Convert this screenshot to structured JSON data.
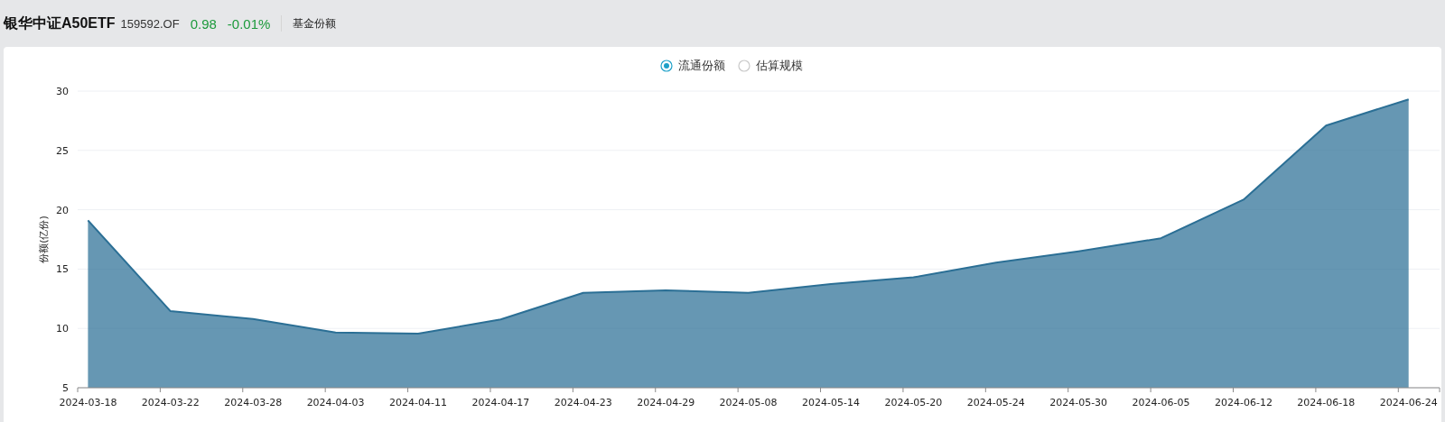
{
  "header": {
    "title": "银华中证A50ETF",
    "code": "159592.OF",
    "price": "0.98",
    "change": "-0.01%",
    "tab": "基金份额"
  },
  "legend": [
    {
      "label": "流通份额",
      "selected": true
    },
    {
      "label": "估算规模",
      "selected": false
    }
  ],
  "chart_data": {
    "type": "area",
    "ylabel": "份额(亿份)",
    "ylim": [
      5,
      30
    ],
    "yticks": [
      5,
      10,
      15,
      20,
      25,
      30
    ],
    "grid": true,
    "categories": [
      "2024-03-18",
      "2024-03-22",
      "2024-03-28",
      "2024-04-03",
      "2024-04-11",
      "2024-04-17",
      "2024-04-23",
      "2024-04-29",
      "2024-05-08",
      "2024-05-14",
      "2024-05-20",
      "2024-05-24",
      "2024-05-30",
      "2024-06-05",
      "2024-06-12",
      "2024-06-18",
      "2024-06-24"
    ],
    "series": [
      {
        "color": "#2b6f95",
        "values": [
          19.1,
          11.45,
          10.8,
          9.65,
          9.55,
          10.75,
          13.0,
          13.2,
          13.0,
          13.75,
          14.3,
          15.55,
          16.5,
          17.6,
          20.85,
          27.1,
          29.3
        ]
      }
    ]
  }
}
